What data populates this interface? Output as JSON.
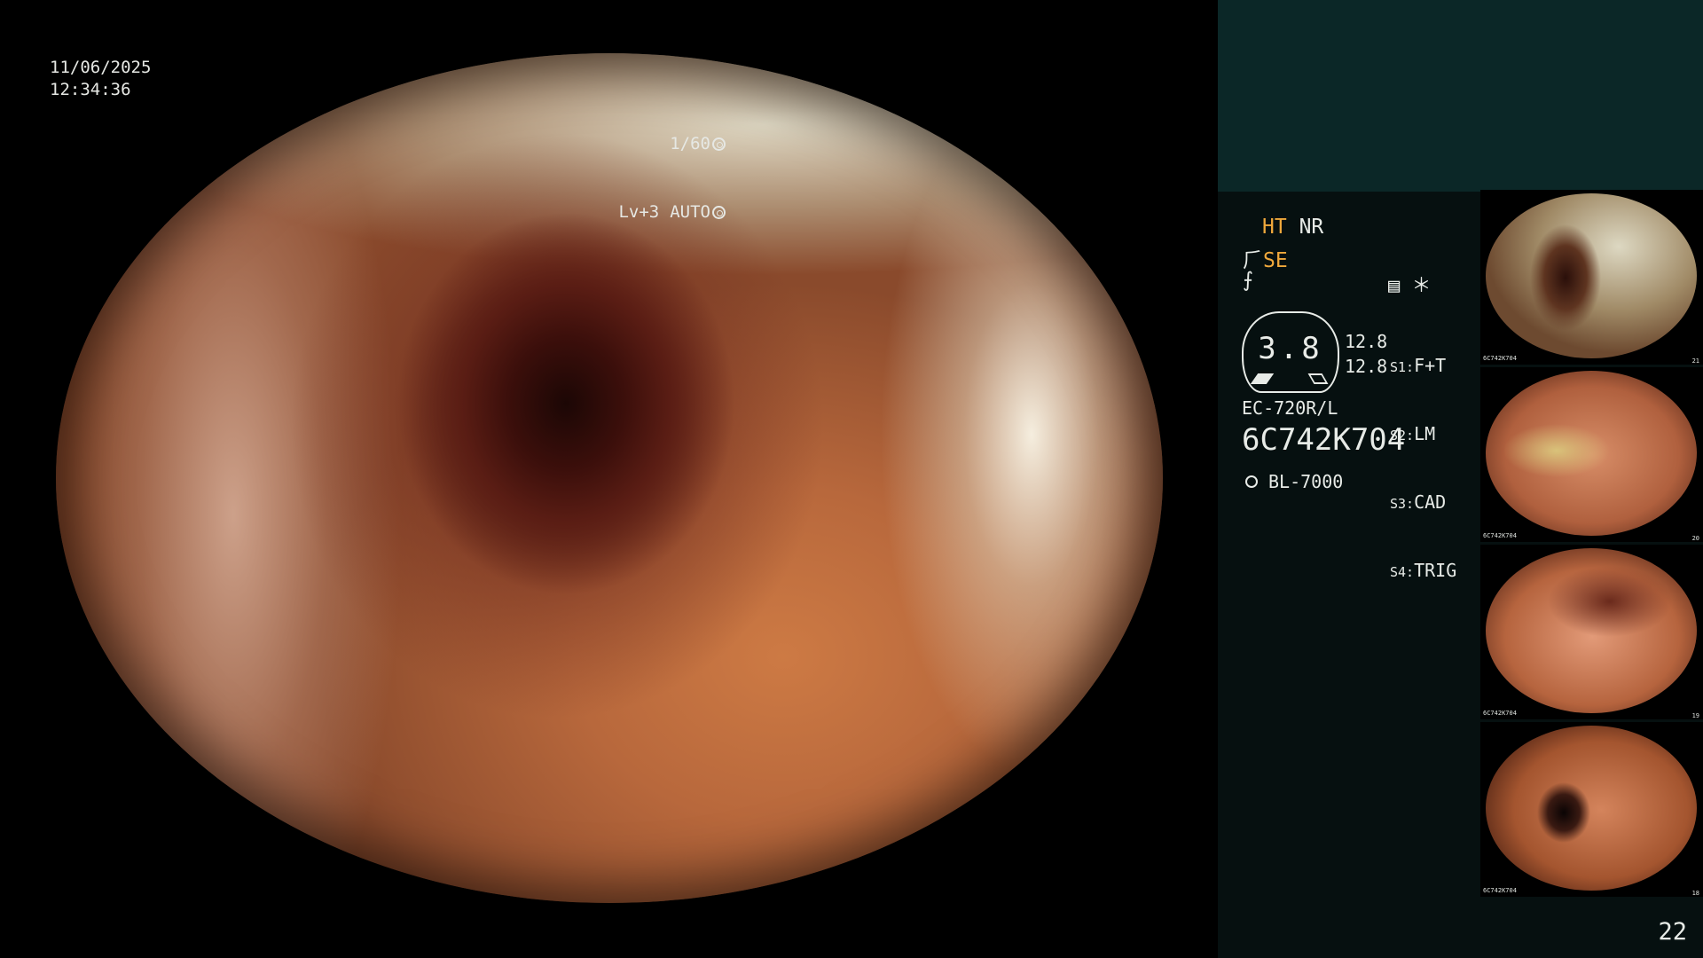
{
  "main_view": {
    "date": "11/06/2025",
    "time": "12:34:36",
    "shutter": "1/60",
    "level": "Lv+3",
    "iris_mode": "AUTO",
    "shutter_icon": "shutter-icon",
    "iris_icon": "iris-icon"
  },
  "panel": {
    "modes": {
      "ht": "HT",
      "nr": "NR",
      "se_symbol": "⺁",
      "se": "SE",
      "f_symbol": "⨍",
      "capture_icons": "▤ ＊"
    },
    "gauge_value": "3.8",
    "zoom": [
      "12.8",
      "12.8"
    ],
    "presets": [
      {
        "key": "S1:",
        "value": "F+T"
      },
      {
        "key": "S2:",
        "value": "LM"
      },
      {
        "key": "S3:",
        "value": "CAD"
      },
      {
        "key": "S4:",
        "value": "TRIG"
      }
    ],
    "scope_model": "EC-720R/L",
    "serial": "6C742K704",
    "light_source": "BL-7000",
    "page_number": "22"
  },
  "thumbnails": [
    {
      "label": "6C742K704",
      "num": "21"
    },
    {
      "label": "6C742K704",
      "num": "20"
    },
    {
      "label": "6C742K704",
      "num": "19"
    },
    {
      "label": "6C742K704",
      "num": "18"
    }
  ],
  "colors": {
    "accent": "#f0a93c",
    "panel_bg": "#061010",
    "panel_header": "#0b2727"
  }
}
